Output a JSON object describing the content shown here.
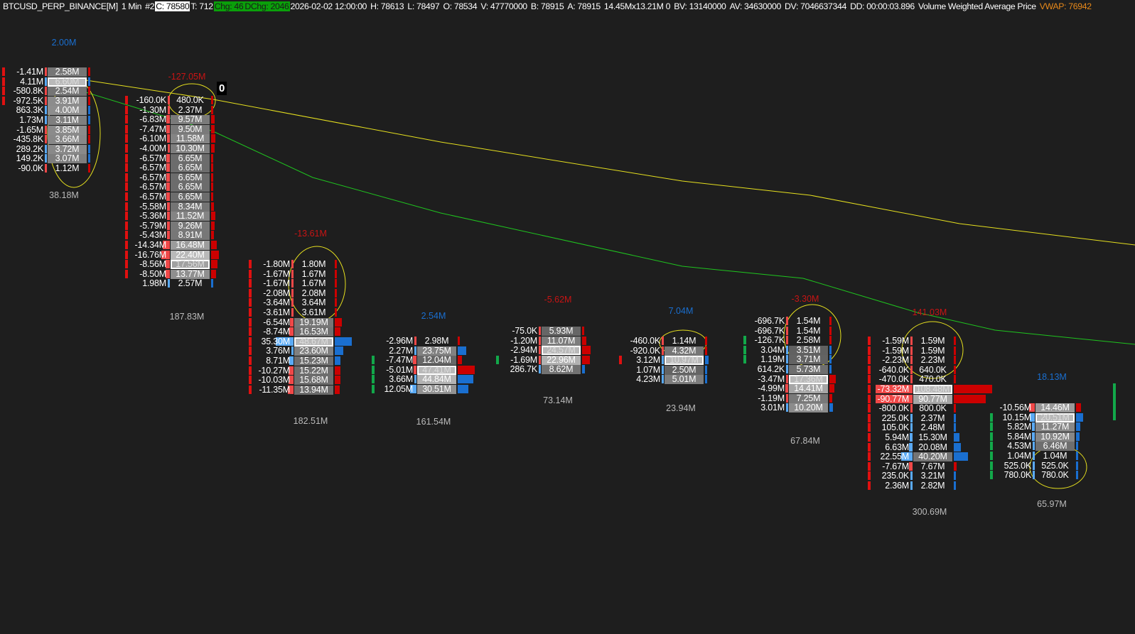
{
  "header": {
    "symbol": "BTCUSD_PERP_BINANCE[M]",
    "timeframe": "1 Min",
    "chart_no": "#2",
    "close": "C: 78580",
    "trades": "T: 712",
    "change": "Chg: 46",
    "daily_change": "DChg: 2046",
    "datetime": "2026-02-02 12:00:00",
    "high": "H: 78613",
    "low": "L: 78497",
    "open": "O: 78534",
    "volume": "V: 47770000",
    "bid": "B: 78915",
    "ask": "A: 78915",
    "size": "14.45Mx13.21M 0",
    "bid_volume": "BV: 13140000",
    "ask_volume": "AV: 34630000",
    "delta_volume": "DV: 7046637344",
    "duration": "DD: 00:00:03.896",
    "study": "Volume Weighted Average Price",
    "vwap": "VWAP: 76942"
  },
  "price_marker": "0",
  "colors": {
    "vwap": "#e6e01e",
    "band": "#1fc41f",
    "sell": "#e01010",
    "buy": "#1a6fd0",
    "sell_light": "#f04848",
    "buy_light": "#5aaaf5",
    "green_marker": "#12a84a",
    "blue_label": "#1a6fd0",
    "red_label": "#c81414"
  },
  "clusters": [
    {
      "top": "2.00M",
      "top_color": "blue",
      "total": "38.18M",
      "poc": 1,
      "markers": [
        "r",
        "r",
        "r",
        "r",
        null,
        null,
        null,
        null,
        null,
        null,
        null
      ],
      "rows": [
        [
          "-1.41M",
          "2.58M"
        ],
        [
          "4.11M",
          "6.60M"
        ],
        [
          "-580.8K",
          "2.54M"
        ],
        [
          "-972.5K",
          "3.91M"
        ],
        [
          "863.3K",
          "4.00M"
        ],
        [
          "1.73M",
          "3.11M"
        ],
        [
          "-1.65M",
          "3.85M"
        ],
        [
          "-435.8K",
          "3.66M"
        ],
        [
          "289.2K",
          "3.72M"
        ],
        [
          "149.2K",
          "3.07M"
        ],
        [
          "-90.0K",
          "1.12M"
        ]
      ]
    },
    {
      "top": "-127.05M",
      "top_color": "red",
      "total": "187.83M",
      "poc": 17,
      "markers": [
        "r",
        "r",
        "r",
        "r",
        "r",
        "r",
        "r",
        "r",
        "r",
        "r",
        "r",
        "r",
        "r",
        "r",
        "r",
        "r",
        "r",
        "r",
        "r",
        null
      ],
      "rows": [
        [
          "-160.0K",
          "480.0K"
        ],
        [
          "-1.30M",
          "2.37M"
        ],
        [
          "-6.83M",
          "9.57M"
        ],
        [
          "-7.47M",
          "9.50M"
        ],
        [
          "-6.10M",
          "11.58M"
        ],
        [
          "-4.00M",
          "10.30M"
        ],
        [
          "-6.57M",
          "6.65M"
        ],
        [
          "-6.57M",
          "6.65M"
        ],
        [
          "-6.57M",
          "6.65M"
        ],
        [
          "-6.57M",
          "6.65M"
        ],
        [
          "-6.57M",
          "6.65M"
        ],
        [
          "-5.58M",
          "8.34M"
        ],
        [
          "-5.36M",
          "11.52M"
        ],
        [
          "-5.79M",
          "9.26M"
        ],
        [
          "-5.43M",
          "8.91M"
        ],
        [
          "-14.34M",
          "16.48M"
        ],
        [
          "-16.76M",
          "22.40M"
        ],
        [
          "-8.56M",
          "17.56M"
        ],
        [
          "-8.50M",
          "13.77M"
        ],
        [
          "1.98M",
          "2.57M"
        ]
      ]
    },
    {
      "top": "-13.61M",
      "top_color": "red",
      "total": "182.51M",
      "poc": 8,
      "markers": [
        "r",
        "r",
        "r",
        "r",
        "r",
        "r",
        "r",
        "r",
        "r",
        "r",
        "r",
        "r",
        "r",
        "r"
      ],
      "rows": [
        [
          "-1.80M",
          "1.80M"
        ],
        [
          "-1.67M",
          "1.67M"
        ],
        [
          "-1.67M",
          "1.67M"
        ],
        [
          "-2.08M",
          "2.08M"
        ],
        [
          "-3.64M",
          "3.64M"
        ],
        [
          "-3.61M",
          "3.61M"
        ],
        [
          "-6.54M",
          "19.19M"
        ],
        [
          "-8.74M",
          "16.53M"
        ],
        [
          "35.30M",
          "48.67M"
        ],
        [
          "3.76M",
          "23.60M"
        ],
        [
          "8.71M",
          "15.23M"
        ],
        [
          "-10.27M",
          "15.22M"
        ],
        [
          "-10.03M",
          "15.68M"
        ],
        [
          "-11.35M",
          "13.94M"
        ]
      ]
    },
    {
      "top": "2.54M",
      "top_color": "blue",
      "total": "161.54M",
      "poc": 3,
      "markers": [
        null,
        null,
        "g",
        "g",
        "g",
        "g"
      ],
      "rows": [
        [
          "-2.96M",
          "2.98M"
        ],
        [
          "2.27M",
          "23.75M"
        ],
        [
          "-7.47M",
          "12.04M"
        ],
        [
          "-5.01M",
          "47.41M"
        ],
        [
          "3.66M",
          "44.84M"
        ],
        [
          "12.05M",
          "30.51M"
        ]
      ]
    },
    {
      "top": "-5.62M",
      "top_color": "red",
      "total": "73.14M",
      "poc": 2,
      "markers": [
        null,
        null,
        null,
        "g",
        null
      ],
      "rows": [
        [
          "-75.0K",
          "5.93M"
        ],
        [
          "-1.20M",
          "11.07M"
        ],
        [
          "-2.94M",
          "24.57M"
        ],
        [
          "-1.69M",
          "22.96M"
        ],
        [
          "286.7K",
          "8.62M"
        ]
      ]
    },
    {
      "top": "7.04M",
      "top_color": "blue",
      "total": "23.94M",
      "poc": 2,
      "markers": [
        null,
        null,
        "r",
        null,
        null
      ],
      "rows": [
        [
          "-460.0K",
          "1.14M"
        ],
        [
          "-920.0K",
          "4.32M"
        ],
        [
          "3.12M",
          "10.97M"
        ],
        [
          "1.07M",
          "2.50M"
        ],
        [
          "4.23M",
          "5.01M"
        ]
      ]
    },
    {
      "top": "-3.30M",
      "top_color": "red",
      "total": "67.84M",
      "poc": 6,
      "markers": [
        null,
        null,
        "g",
        "g",
        "g",
        null,
        null,
        null,
        null,
        null
      ],
      "rows": [
        [
          "-696.7K",
          "1.54M"
        ],
        [
          "-696.7K",
          "1.54M"
        ],
        [
          "-126.7K",
          "2.58M"
        ],
        [
          "3.04M",
          "3.51M"
        ],
        [
          "1.19M",
          "3.71M"
        ],
        [
          "614.2K",
          "5.73M"
        ],
        [
          "-3.47M",
          "17.36M"
        ],
        [
          "-4.99M",
          "14.41M"
        ],
        [
          "-1.19M",
          "7.25M"
        ],
        [
          "3.01M",
          "10.20M"
        ]
      ]
    },
    {
      "top": "141.03M",
      "top_color": "red",
      "total": "300.69M",
      "poc": 5,
      "markers": [
        "r",
        "r",
        "r",
        "r",
        "r",
        "r",
        "r",
        "r",
        "r",
        "r",
        "r",
        "r",
        "r",
        "r",
        "r",
        "r"
      ],
      "rows": [
        [
          "-1.59M",
          "1.59M"
        ],
        [
          "-1.59M",
          "1.59M"
        ],
        [
          "-2.23M",
          "2.23M"
        ],
        [
          "-640.0K",
          "640.0K"
        ],
        [
          "-470.0K",
          "470.0K"
        ],
        [
          "-73.32M",
          "108.48M"
        ],
        [
          "-90.77M",
          "90.77M"
        ],
        [
          "-800.0K",
          "800.0K"
        ],
        [
          "225.0K",
          "2.37M"
        ],
        [
          "105.0K",
          "2.48M"
        ],
        [
          "5.94M",
          "15.30M"
        ],
        [
          "6.63M",
          "20.08M"
        ],
        [
          "22.55M",
          "40.20M"
        ],
        [
          "-7.67M",
          "7.67M"
        ],
        [
          "235.0K",
          "3.21M"
        ],
        [
          "2.36M",
          "2.82M"
        ]
      ]
    },
    {
      "top": "18.13M",
      "top_color": "blue",
      "total": "65.97M",
      "poc": 1,
      "markers": [
        null,
        "g",
        "g",
        "g",
        "g",
        "g",
        "g",
        "g"
      ],
      "rows": [
        [
          "-10.56M",
          "14.46M"
        ],
        [
          "10.15M",
          "20.51M"
        ],
        [
          "5.82M",
          "11.27M"
        ],
        [
          "5.84M",
          "10.92M"
        ],
        [
          "4.53M",
          "6.46M"
        ],
        [
          "1.04M",
          "1.04M"
        ],
        [
          "525.0K",
          "525.0K"
        ],
        [
          "780.0K",
          "780.0K"
        ]
      ]
    }
  ]
}
